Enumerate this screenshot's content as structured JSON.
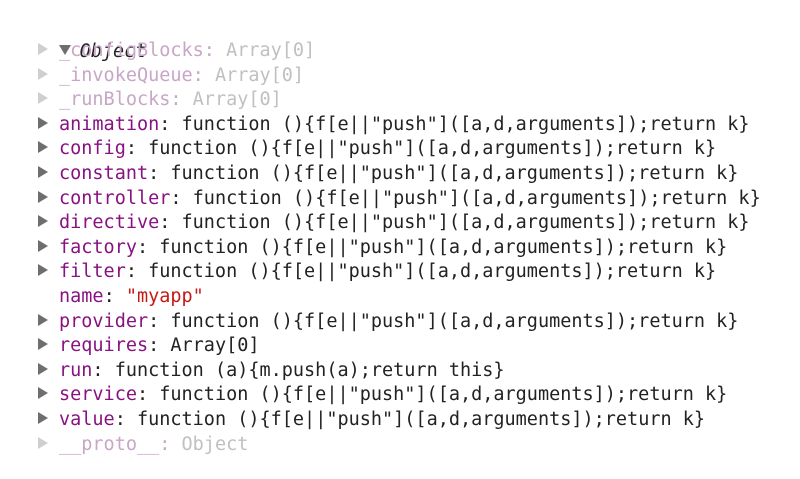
{
  "console": {
    "root_label": "Object",
    "properties": [
      {
        "key": "_configBlocks",
        "value": "Array[0]",
        "expandable": true,
        "dim": true
      },
      {
        "key": "_invokeQueue",
        "value": "Array[0]",
        "expandable": true,
        "dim": true
      },
      {
        "key": "_runBlocks",
        "value": "Array[0]",
        "expandable": true,
        "dim": true
      },
      {
        "key": "animation",
        "value": "function (){f[e||\"push\"]([a,d,arguments]);return k}",
        "expandable": true,
        "dim": false
      },
      {
        "key": "config",
        "value": "function (){f[e||\"push\"]([a,d,arguments]);return k}",
        "expandable": true,
        "dim": false
      },
      {
        "key": "constant",
        "value": "function (){f[e||\"push\"]([a,d,arguments]);return k}",
        "expandable": true,
        "dim": false
      },
      {
        "key": "controller",
        "value": "function (){f[e||\"push\"]([a,d,arguments]);return k}",
        "expandable": true,
        "dim": false
      },
      {
        "key": "directive",
        "value": "function (){f[e||\"push\"]([a,d,arguments]);return k}",
        "expandable": true,
        "dim": false
      },
      {
        "key": "factory",
        "value": "function (){f[e||\"push\"]([a,d,arguments]);return k}",
        "expandable": true,
        "dim": false
      },
      {
        "key": "filter",
        "value": "function (){f[e||\"push\"]([a,d,arguments]);return k}",
        "expandable": true,
        "dim": false
      },
      {
        "key": "name",
        "value": "\"myapp\"",
        "expandable": false,
        "dim": false,
        "string": true
      },
      {
        "key": "provider",
        "value": "function (){f[e||\"push\"]([a,d,arguments]);return k}",
        "expandable": true,
        "dim": false
      },
      {
        "key": "requires",
        "value": "Array[0]",
        "expandable": true,
        "dim": false
      },
      {
        "key": "run",
        "value": "function (a){m.push(a);return this}",
        "expandable": true,
        "dim": false
      },
      {
        "key": "service",
        "value": "function (){f[e||\"push\"]([a,d,arguments]);return k}",
        "expandable": true,
        "dim": false
      },
      {
        "key": "value",
        "value": "function (){f[e||\"push\"]([a,d,arguments]);return k}",
        "expandable": true,
        "dim": false
      },
      {
        "key": "__proto__",
        "value": "Object",
        "expandable": true,
        "dim": true
      }
    ],
    "separator": ": ",
    "colors": {
      "key": "#881280",
      "string": "#c41a16",
      "text": "#222222",
      "arrow": "#6e6e6e"
    },
    "icons": {
      "root": "triangle-down-icon",
      "child": "triangle-right-icon"
    }
  }
}
